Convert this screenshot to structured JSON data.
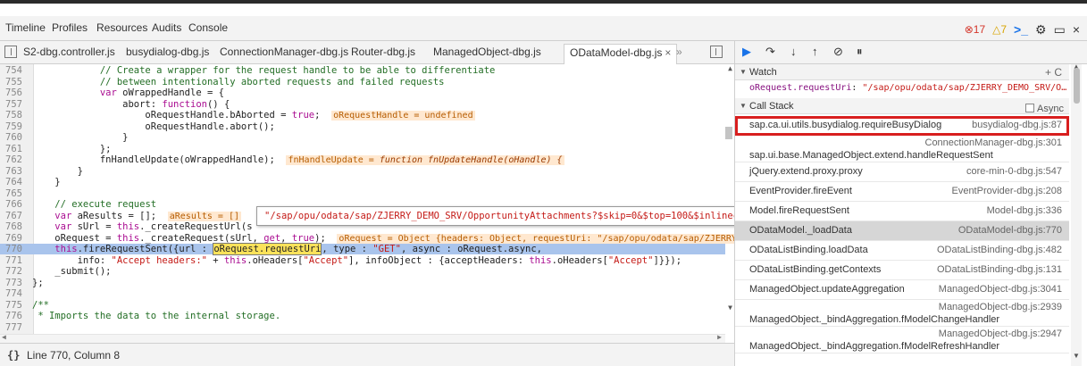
{
  "menubar": {
    "items": [
      "Timeline",
      "Profiles",
      "Resources",
      "Audits",
      "Console"
    ],
    "errors": "17",
    "warnings": "7",
    "error_icon": "error-circle-icon",
    "warning_icon": "warning-triangle-icon"
  },
  "tabs": {
    "files": [
      "S2-dbg.controller.js",
      "busydialog-dbg.js",
      "ConnectionManager-dbg.js",
      "Router-dbg.js",
      "ManagedObject-dbg.js"
    ],
    "active": "ODataModel-dbg.js",
    "overflow": "»"
  },
  "editor": {
    "lines": [
      {
        "n": "754",
        "html": "            <span class=\"c-comment\">// Create a wrapper for the request handle to be able to differentiate</span>"
      },
      {
        "n": "755",
        "html": "            <span class=\"c-comment\">// between intentionally aborted requests and failed requests</span>"
      },
      {
        "n": "756",
        "html": "            <span class=\"c-kw\">var</span> oWrappedHandle = {"
      },
      {
        "n": "757",
        "html": "                abort: <span class=\"c-kw\">function</span>() {"
      },
      {
        "n": "758",
        "html": "                    oRequestHandle.bAborted = <span class=\"c-kw\">true</span>;  <span class=\"inline-val\">oRequestHandle = undefined</span>"
      },
      {
        "n": "759",
        "html": "                    oRequestHandle.abort();"
      },
      {
        "n": "760",
        "html": "                }"
      },
      {
        "n": "761",
        "html": "            };"
      },
      {
        "n": "762",
        "html": "            fnHandleUpdate(oWrappedHandle);  <span class=\"inline-val\">fnHandleUpdate = <i>function fnUpdateHandle(oHandle) {</i></span>"
      },
      {
        "n": "763",
        "html": "        }"
      },
      {
        "n": "764",
        "html": "    }"
      },
      {
        "n": "765",
        "html": ""
      },
      {
        "n": "766",
        "html": "    <span class=\"c-comment\">// execute request</span>"
      },
      {
        "n": "767",
        "html": "    <span class=\"c-kw\">var</span> aResults = [];  <span class=\"inline-val\">aResults = []</span>"
      },
      {
        "n": "768",
        "html": "    <span class=\"c-kw\">var</span> sUrl = <span class=\"c-kw\">this</span>._createRequestUrl(s"
      },
      {
        "n": "769",
        "html": "    oRequest = <span class=\"c-kw\">this</span>._createRequest(sUrl, <span class=\"c-kw\">get</span>, <span class=\"c-kw\">true</span>);  <span class=\"inline-val\">oRequest = Object {headers: Object, requestUri: \"/sap/opu/odata/sap/ZJERRY_DEMO_SRV/OpportunityAttachments</span>"
      },
      {
        "n": "770",
        "html": "    <span class=\"c-kw\">this</span>.fireRequestSent({url : <span class=\"c-hl-var\">oRequest.requestUri</span>, type : <span class=\"c-str\">\"GET\"</span>, async : oRequest.async,",
        "hl": true
      },
      {
        "n": "771",
        "html": "        info: <span class=\"c-str\">\"Accept headers:\"</span> + <span class=\"c-kw\">this</span>.oHeaders[<span class=\"c-str\">\"Accept\"</span>], infoObject : {acceptHeaders: <span class=\"c-kw\">this</span>.oHeaders[<span class=\"c-str\">\"Accept\"</span>]}});"
      },
      {
        "n": "772",
        "html": "    _submit();"
      },
      {
        "n": "773",
        "html": "};"
      },
      {
        "n": "774",
        "html": ""
      },
      {
        "n": "775",
        "html": "<span class=\"c-comment\">/**</span>"
      },
      {
        "n": "776",
        "html": "<span class=\"c-comment\"> * Imports the data to the internal storage.</span>"
      },
      {
        "n": "777",
        "html": ""
      }
    ],
    "tooltip": "\"/sap/opu/odata/sap/ZJERRY_DEMO_SRV/OpportunityAttachments?$skip=0&$top=100&$inlinecount=allpages\""
  },
  "status": {
    "braces": "{}",
    "position": "Line 770, Column 8"
  },
  "sidebar": {
    "watch_label": "Watch",
    "watch_actions": "+ C",
    "watch_name": "oRequest.requestUri",
    "watch_value": "\"/sap/opu/odata/sap/ZJERRY_DEMO_SRV/O…",
    "callstack_label": "Call Stack",
    "async_label": "Async",
    "frames": [
      {
        "fn": "sap.ca.ui.utils.busydialog.requireBusyDialog",
        "loc": "busydialog-dbg.js:87",
        "boxed": true
      },
      {
        "fn": "sap.ui.base.ManagedObject.extend.handleRequestSent",
        "loc": "ConnectionManager-dbg.js:301",
        "two": true
      },
      {
        "fn": "jQuery.extend.proxy.proxy",
        "loc": "core-min-0-dbg.js:547"
      },
      {
        "fn": "EventProvider.fireEvent",
        "loc": "EventProvider-dbg.js:208"
      },
      {
        "fn": "Model.fireRequestSent",
        "loc": "Model-dbg.js:336"
      },
      {
        "fn": "ODataModel._loadData",
        "loc": "ODataModel-dbg.js:770",
        "selected": true
      },
      {
        "fn": "ODataListBinding.loadData",
        "loc": "ODataListBinding-dbg.js:482"
      },
      {
        "fn": "ODataListBinding.getContexts",
        "loc": "ODataListBinding-dbg.js:131"
      },
      {
        "fn": "ManagedObject.updateAggregation",
        "loc": "ManagedObject-dbg.js:3041"
      },
      {
        "fn": "ManagedObject._bindAggregation.fModelChangeHandler",
        "loc": "ManagedObject-dbg.js:2939",
        "two": true
      },
      {
        "fn": "ManagedObject._bindAggregation.fModelRefreshHandler",
        "loc": "ManagedObject-dbg.js:2947",
        "two": true
      }
    ]
  }
}
